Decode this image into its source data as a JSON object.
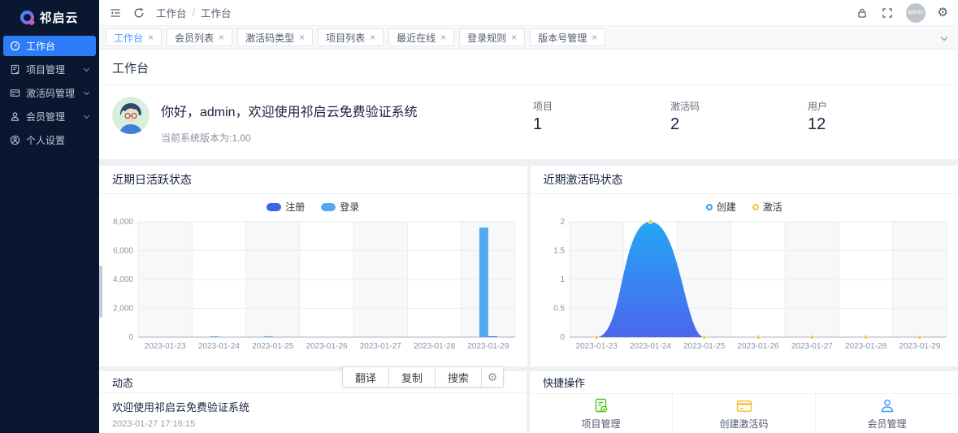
{
  "brand": {
    "name": "祁启云"
  },
  "topbar": {
    "breadcrumb_1": "工作台",
    "breadcrumb_sep": "/",
    "breadcrumb_2": "工作台",
    "username": "admin"
  },
  "sidebar": {
    "items": [
      {
        "label": "工作台",
        "icon": "dashboard-icon",
        "active": true,
        "expandable": false
      },
      {
        "label": "项目管理",
        "icon": "project-icon",
        "active": false,
        "expandable": true
      },
      {
        "label": "激活码管理",
        "icon": "activation-icon",
        "active": false,
        "expandable": true
      },
      {
        "label": "会员管理",
        "icon": "member-icon",
        "active": false,
        "expandable": true
      },
      {
        "label": "个人设置",
        "icon": "profile-icon",
        "active": false,
        "expandable": false
      }
    ]
  },
  "tabs": [
    {
      "label": "工作台",
      "active": true
    },
    {
      "label": "会员列表",
      "active": false
    },
    {
      "label": "激活码类型",
      "active": false
    },
    {
      "label": "项目列表",
      "active": false
    },
    {
      "label": "最近在线",
      "active": false
    },
    {
      "label": "登录规则",
      "active": false
    },
    {
      "label": "版本号管理",
      "active": false
    }
  ],
  "page_title": "工作台",
  "welcome": {
    "greeting": "你好，admin，欢迎使用祁启云免费验证系统",
    "version_note": "当前系统版本为:1.00"
  },
  "stats": [
    {
      "label": "项目",
      "value": "1"
    },
    {
      "label": "激活码",
      "value": "2"
    },
    {
      "label": "用户",
      "value": "12"
    }
  ],
  "chart_data": [
    {
      "type": "bar",
      "title": "近期日活跃状态",
      "categories": [
        "2023-01-23",
        "2023-01-24",
        "2023-01-25",
        "2023-01-26",
        "2023-01-27",
        "2023-01-28",
        "2023-01-29"
      ],
      "series": [
        {
          "name": "注册",
          "color": "#3d63e6",
          "values": [
            0,
            0,
            0,
            0,
            0,
            0,
            40
          ]
        },
        {
          "name": "登录",
          "color": "#54a8f0",
          "values": [
            0,
            30,
            60,
            0,
            0,
            0,
            7600
          ]
        }
      ],
      "xlabel": "",
      "ylabel": "",
      "ylim": [
        0,
        8000
      ],
      "yticks": [
        {
          "v": 0,
          "label": "0"
        },
        {
          "v": 2000,
          "label": "2,000"
        },
        {
          "v": 4000,
          "label": "4,000"
        },
        {
          "v": 6000,
          "label": "6,000"
        },
        {
          "v": 8000,
          "label": "8,000"
        }
      ],
      "grid": true,
      "legend_position": "top"
    },
    {
      "type": "area",
      "title": "近期激活码状态",
      "categories": [
        "2023-01-23",
        "2023-01-24",
        "2023-01-25",
        "2023-01-26",
        "2023-01-27",
        "2023-01-28",
        "2023-01-29"
      ],
      "series": [
        {
          "name": "创建",
          "color": "#2f9ff2",
          "gradient": [
            "#24a6f5",
            "#4c66ee"
          ],
          "values": [
            0,
            2,
            0,
            0,
            0,
            0,
            0
          ]
        },
        {
          "name": "激活",
          "color": "#f5c53c",
          "values": [
            0,
            2,
            0,
            0,
            0,
            0,
            0
          ]
        }
      ],
      "xlabel": "",
      "ylabel": "",
      "ylim": [
        0,
        2
      ],
      "yticks": [
        {
          "v": 0,
          "label": "0"
        },
        {
          "v": 0.5,
          "label": "0.5"
        },
        {
          "v": 1,
          "label": "1"
        },
        {
          "v": 1.5,
          "label": "1.5"
        },
        {
          "v": 2,
          "label": "2"
        }
      ],
      "grid": true,
      "legend_position": "top"
    }
  ],
  "feed": {
    "title": "动态",
    "message": "欢迎使用祁启云免费验证系统",
    "time": "2023-01-27 17:16:15",
    "toolbar": [
      {
        "label": "翻译"
      },
      {
        "label": "复制"
      },
      {
        "label": "搜索"
      }
    ]
  },
  "quick_actions": {
    "title": "快捷操作",
    "items": [
      {
        "label": "项目管理",
        "icon": "project-manage-icon",
        "color": "#52c41a"
      },
      {
        "label": "创建激活码",
        "icon": "create-code-icon",
        "color": "#f7ba2a"
      },
      {
        "label": "会员管理",
        "icon": "member-manage-icon",
        "color": "#409eff"
      }
    ]
  },
  "colors": {
    "accent": "#2b7cf6",
    "sidebar_bg": "#0a1730",
    "tab_active_text": "#409eff",
    "bar_register": "#3d63e6",
    "bar_login": "#54a8f0",
    "area_gradient_top": "#24a6f5",
    "area_gradient_bottom": "#4c66ee",
    "marker_yellow": "#f5c53c",
    "quick_green": "#52c41a",
    "quick_orange": "#f7ba2a",
    "quick_blue": "#409eff"
  }
}
